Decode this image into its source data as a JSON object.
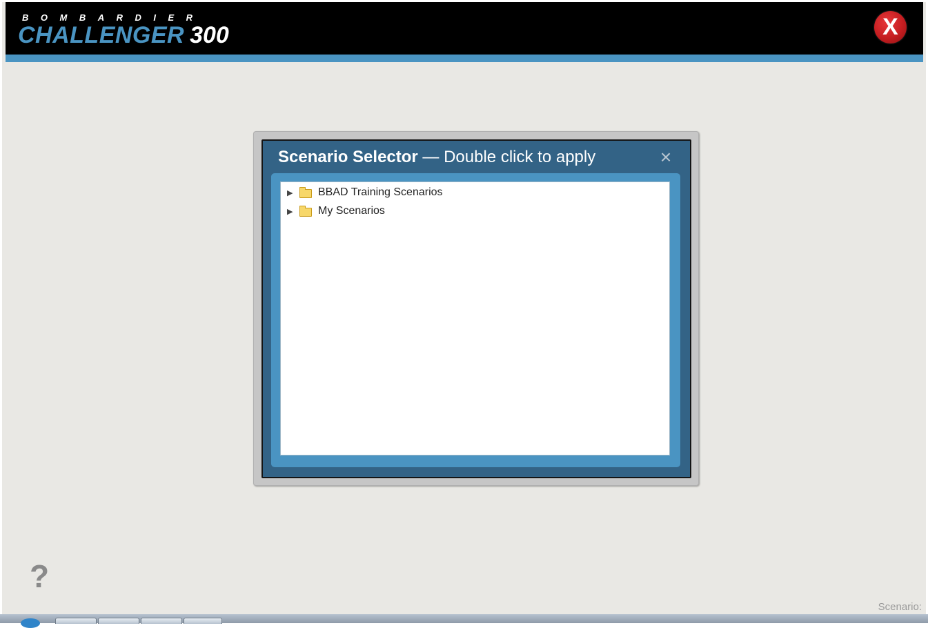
{
  "header": {
    "brand_small": "BOMBARDIER",
    "brand_model": "CHALLENGER",
    "brand_number": "300",
    "close_label": "X",
    "colors": {
      "banner": "#000000",
      "accent": "#4a94c2",
      "close": "#c51d20"
    }
  },
  "dialog": {
    "title_bold": "Scenario Selector",
    "title_rest": " — Double click to apply",
    "close_icon": "close-icon",
    "tree": [
      {
        "label": "BBAD Training Scenarios",
        "icon": "folder-icon",
        "expander": "▶"
      },
      {
        "label": "My Scenarios",
        "icon": "folder-icon",
        "expander": "▶"
      }
    ]
  },
  "footer": {
    "help": "?",
    "scenario_label": "Scenario:"
  }
}
